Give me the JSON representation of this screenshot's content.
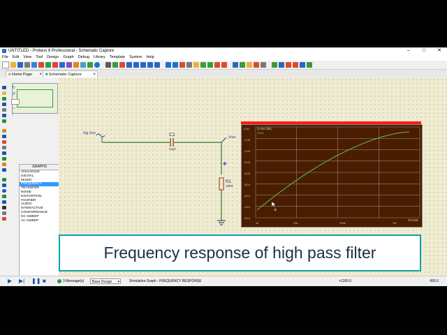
{
  "window": {
    "title": "UNTITLED - Proteus 8 Professional - Schematic Capture",
    "controls": {
      "minimize": "–",
      "maximize": "□",
      "close": "✕"
    }
  },
  "menu": [
    "File",
    "Edit",
    "View",
    "Tool",
    "Design",
    "Graph",
    "Debug",
    "Library",
    "Template",
    "System",
    "Help"
  ],
  "tabs": [
    {
      "label": "Home Page",
      "active": false
    },
    {
      "label": "Schematic Capture",
      "active": true
    }
  ],
  "graphs_panel": {
    "header": "GRAPHS",
    "items": [
      "ANALOGUE",
      "DIGITAL",
      "MIXED",
      "FREQUENCY",
      "TRANSFER",
      "NOISE",
      "DISTORTION",
      "FOURIER",
      "AUDIO",
      "INTERACTIVE",
      "CONFORMANCE",
      "DC SWEEP",
      "AC SWEEP"
    ],
    "selected": "FREQUENCY"
  },
  "schematic": {
    "source_label": "Sig Gen",
    "capacitor_ref": "C1",
    "capacitor_value": "21pF",
    "output_label": "Vout",
    "resistor_ref": "R1",
    "resistor_value": "150R"
  },
  "graph": {
    "header_text": "GAIN (dB)",
    "trace_label": "Vout",
    "y_ticks": [
      "0.00",
      "-2.00",
      "-4.00",
      "-6.00",
      "-8.00",
      "-10.0",
      "-12.0",
      "-14.0",
      "-16.0"
    ],
    "x_ticks": [
      "1k",
      "10k",
      "100k",
      "1M"
    ],
    "phase_label": "PHASE",
    "colors": {
      "background": "#4b1d00",
      "grid": "#9a9a9a",
      "trace": "#5fc24a",
      "title_strip": "#ff1a1a"
    }
  },
  "caption": "Frequency response of high pass filter",
  "status": {
    "messages": "3 Message(s)",
    "design": "Base Design",
    "info": "Simulation Graph - FREQUENCY RESPONSE",
    "coord_x": "+1200.0",
    "coord_y": "-900.0"
  }
}
